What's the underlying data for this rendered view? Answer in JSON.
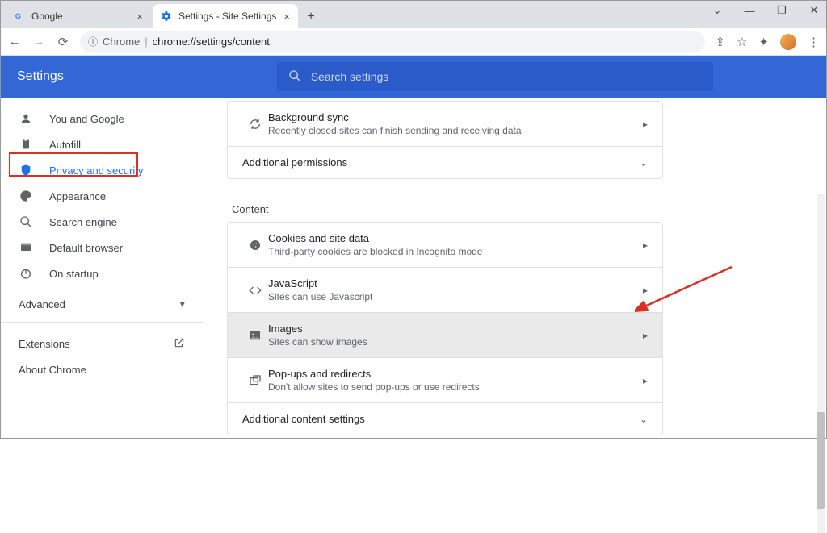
{
  "tabs": [
    {
      "label": "Google",
      "favicon": "G"
    },
    {
      "label": "Settings - Site Settings",
      "favicon": "gear"
    }
  ],
  "toolbar": {
    "chrome_label": "Chrome",
    "url_path": "chrome://settings/content"
  },
  "settings": {
    "title": "Settings",
    "search_placeholder": "Search settings"
  },
  "sidebar": {
    "items": [
      {
        "label": "You and Google"
      },
      {
        "label": "Autofill"
      },
      {
        "label": "Privacy and security"
      },
      {
        "label": "Appearance"
      },
      {
        "label": "Search engine"
      },
      {
        "label": "Default browser"
      },
      {
        "label": "On startup"
      }
    ],
    "advanced": "Advanced",
    "extensions": "Extensions",
    "about": "About Chrome"
  },
  "main": {
    "bg_sync": {
      "title": "Background sync",
      "sub": "Recently closed sites can finish sending and receiving data"
    },
    "additional_perms": "Additional permissions",
    "content_label": "Content",
    "cookies": {
      "title": "Cookies and site data",
      "sub": "Third-party cookies are blocked in Incognito mode"
    },
    "javascript": {
      "title": "JavaScript",
      "sub": "Sites can use Javascript"
    },
    "images": {
      "title": "Images",
      "sub": "Sites can show images"
    },
    "popups": {
      "title": "Pop-ups and redirects",
      "sub": "Don't allow sites to send pop-ups or use redirects"
    },
    "additional_content": "Additional content settings"
  }
}
